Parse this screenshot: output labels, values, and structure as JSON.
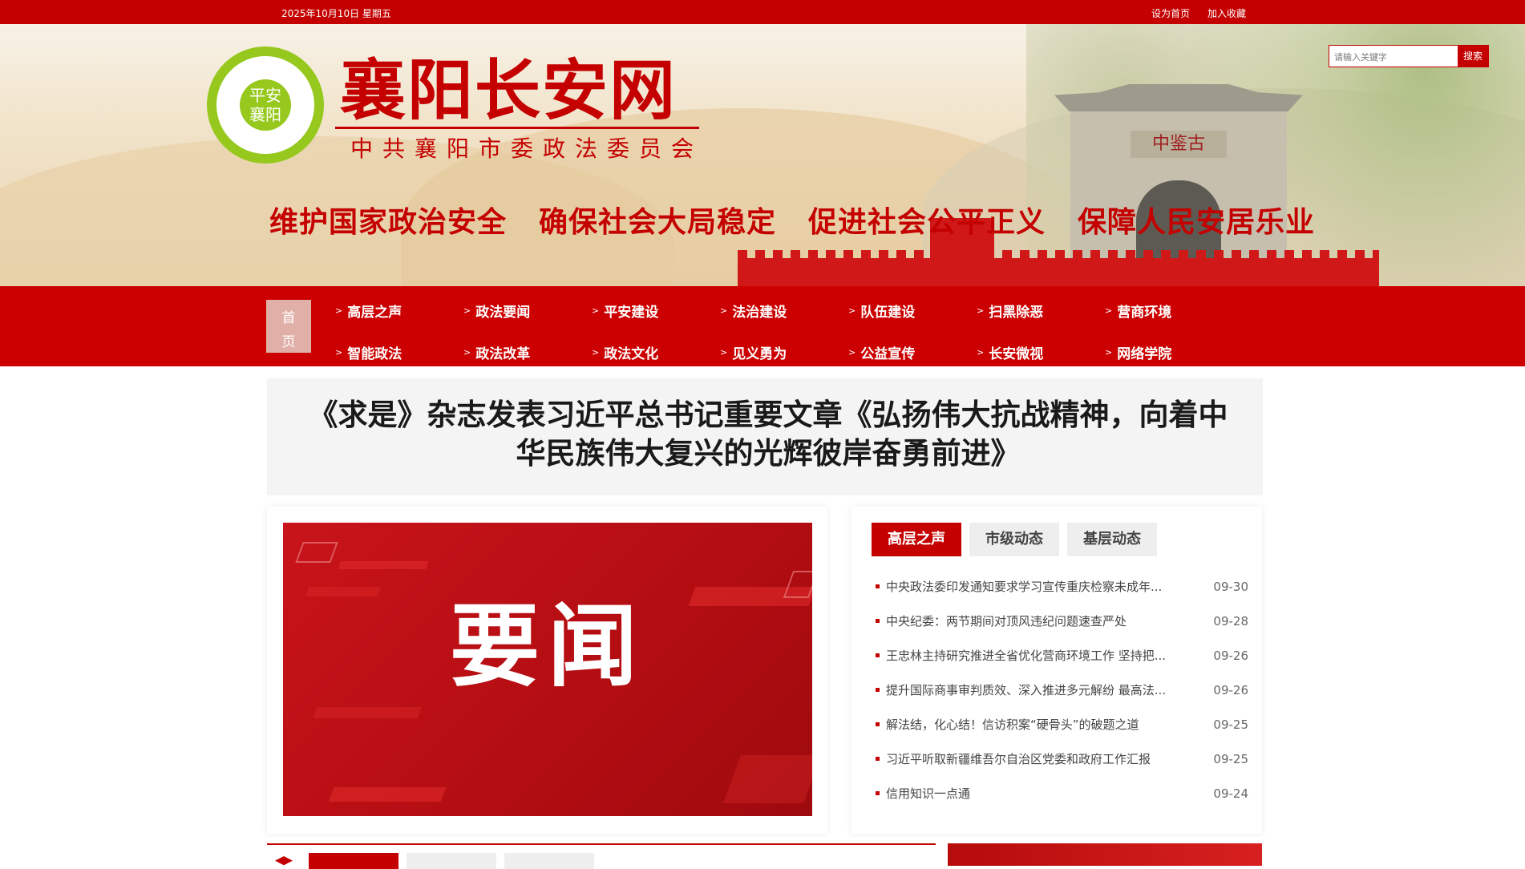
{
  "topbar": {
    "date": "2025年10月10日 星期五",
    "set_home": "设为首页",
    "add_favorite": "加入收藏"
  },
  "banner": {
    "logo_line1": "平安",
    "logo_line2": "襄阳",
    "site_title": "襄阳长安网",
    "site_subtitle": "中共襄阳市委政法委员会",
    "slogans": [
      "维护国家政治安全",
      "确保社会大局稳定",
      "促进社会公平正义",
      "保障人民安居乐业"
    ],
    "gate_plaque": "中鉴古"
  },
  "search": {
    "placeholder": "请输入关键字",
    "button": "搜索"
  },
  "nav": {
    "home": "首页",
    "items": [
      "高层之声",
      "政法要闻",
      "平安建设",
      "法治建设",
      "队伍建设",
      "扫黑除恶",
      "营商环境",
      "智能政法",
      "政法改革",
      "政法文化",
      "见义勇为",
      "公益宣传",
      "长安微视",
      "网络学院"
    ]
  },
  "headline": "《求是》杂志发表习近平总书记重要文章《弘扬伟大抗战精神，向着中华民族伟大复兴的光辉彼岸奋勇前进》",
  "feature_image": {
    "text": "要闻"
  },
  "tabs": [
    "高层之声",
    "市级动态",
    "基层动态"
  ],
  "news": [
    {
      "title": "中央政法委印发通知要求学习宣传重庆检察未成年...",
      "date": "09-30"
    },
    {
      "title": "中央纪委：两节期间对顶风违纪问题速查严处",
      "date": "09-28"
    },
    {
      "title": "王忠林主持研究推进全省优化营商环境工作 坚持把...",
      "date": "09-26"
    },
    {
      "title": "提升国际商事审判质效、深入推进多元解纷 最高法...",
      "date": "09-26"
    },
    {
      "title": "解法结，化心结！信访积案“硬骨头”的破题之道",
      "date": "09-25"
    },
    {
      "title": "习近平听取新疆维吾尔自治区党委和政府工作汇报",
      "date": "09-25"
    },
    {
      "title": "信用知识一点通",
      "date": "09-24"
    }
  ],
  "colors": {
    "brand_red": "#c40000",
    "logo_green": "#96c81e"
  }
}
